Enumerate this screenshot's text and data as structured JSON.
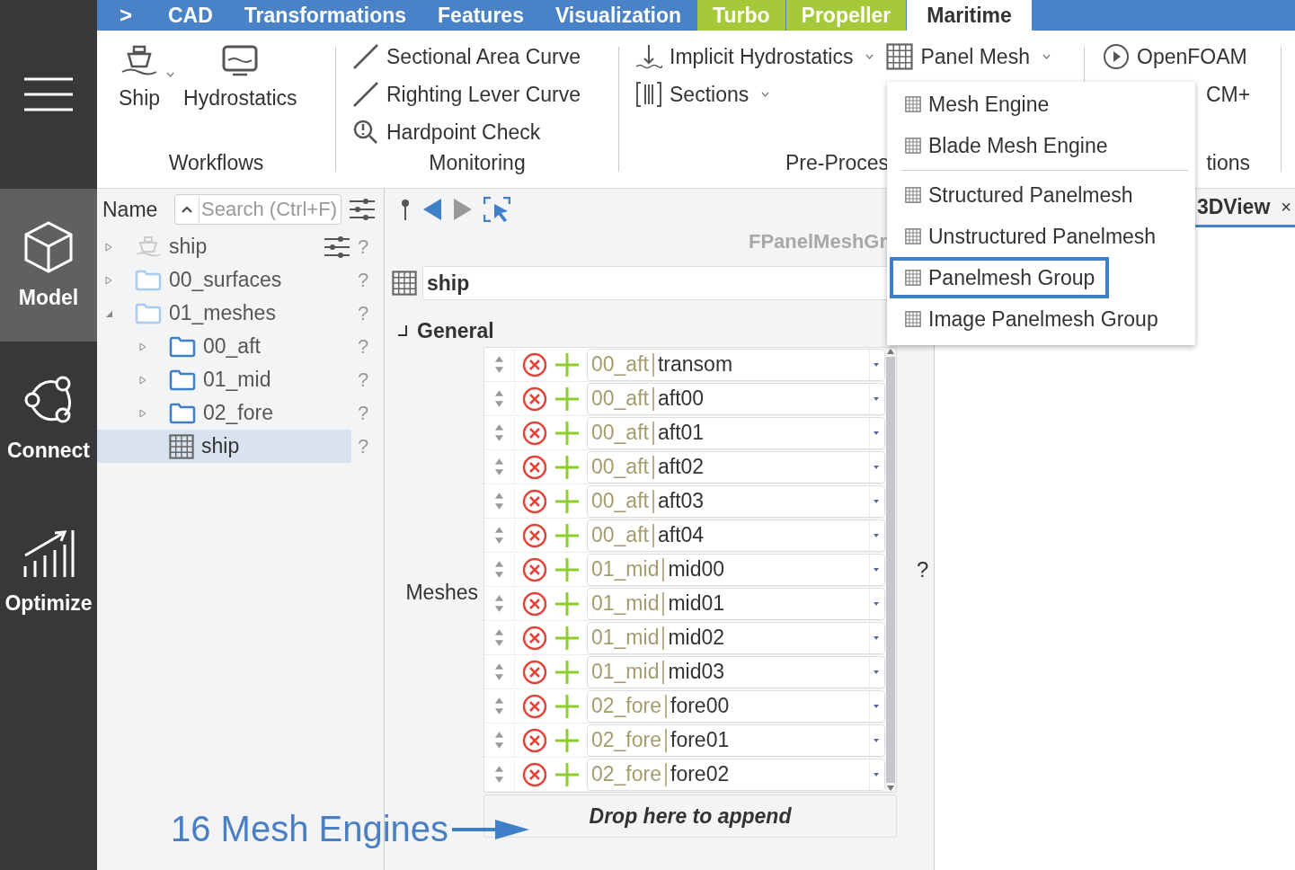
{
  "sidebar": [
    {
      "label": "Model",
      "kind": "cube",
      "selected": true
    },
    {
      "label": "Connect",
      "kind": "connect",
      "selected": false
    },
    {
      "label": "Optimize",
      "kind": "chart",
      "selected": false
    }
  ],
  "expand_glyph": ">",
  "tabs": [
    {
      "label": "CAD",
      "color": "#4a82c8",
      "selected": false
    },
    {
      "label": "Transformations",
      "color": "#4a82c8",
      "selected": false
    },
    {
      "label": "Features",
      "color": "#4a82c8",
      "selected": false
    },
    {
      "label": "Visualization",
      "color": "#4a82c8",
      "selected": false
    },
    {
      "label": "Turbo",
      "color": "#a6c93a",
      "selected": false
    },
    {
      "label": "Propeller",
      "color": "#a6c93a",
      "selected": false
    },
    {
      "label": "Maritime",
      "selected": true
    }
  ],
  "ribbon": {
    "groups": [
      {
        "kind": "large",
        "label": "Workflows",
        "items": [
          {
            "label": "Ship",
            "kind": "ship",
            "dropdown": true
          },
          {
            "label": "Hydrostatics",
            "kind": "monitor",
            "dropdown": false
          }
        ]
      },
      {
        "kind": "list",
        "label": "Monitoring",
        "columns": [
          [
            {
              "label": "Sectional Area Curve",
              "kind": "line",
              "dropdown": false
            },
            {
              "label": "Righting Lever Curve",
              "kind": "line",
              "dropdown": false
            },
            {
              "label": "Hardpoint Check",
              "kind": "magnifier",
              "dropdown": false
            }
          ]
        ]
      },
      {
        "kind": "list",
        "label": "Pre-Proces",
        "columns": [
          [
            {
              "label": "Implicit Hydrostatics",
              "kind": "arrow-down",
              "dropdown": true
            },
            {
              "label": "Sections",
              "kind": "sections",
              "dropdown": true
            }
          ],
          [
            {
              "label": "Panel Mesh",
              "kind": "grid",
              "dropdown": true
            }
          ]
        ]
      },
      {
        "kind": "list",
        "label": "tions",
        "columns": [
          [
            {
              "label": "OpenFOAM",
              "kind": "play",
              "dropdown": false
            },
            {
              "label": "CM+",
              "kind": "text",
              "dropdown": false
            }
          ]
        ]
      }
    ]
  },
  "menu": {
    "sections": [
      {
        "items": [
          {
            "label": "Mesh Engine",
            "selected": false
          },
          {
            "label": "Blade Mesh Engine",
            "selected": false
          }
        ]
      },
      {
        "items": [
          {
            "label": "Structured Panelmesh",
            "selected": false
          },
          {
            "label": "Unstructured Panelmesh",
            "selected": false
          },
          {
            "label": "Panelmesh Group",
            "selected": true
          },
          {
            "label": "Image Panelmesh Group",
            "selected": false
          }
        ]
      }
    ]
  },
  "tree": {
    "header": "Name",
    "search": {
      "placeholder": "Search (Ctrl+F)"
    },
    "nodes": [
      {
        "label": "ship",
        "kind": "ship",
        "help": "?",
        "expanded": false,
        "selected": false
      },
      {
        "label": "00_surfaces",
        "kind": "folder-light",
        "help": "?",
        "expanded": false,
        "selected": false
      },
      {
        "label": "01_meshes",
        "kind": "folder-light",
        "help": "?",
        "expanded": true,
        "selected": false,
        "children": [
          {
            "label": "00_aft",
            "kind": "folder",
            "help": "?",
            "expanded": false,
            "selected": false
          },
          {
            "label": "01_mid",
            "kind": "folder",
            "help": "?",
            "expanded": false,
            "selected": false
          },
          {
            "label": "02_fore",
            "kind": "folder",
            "help": "?",
            "expanded": false,
            "selected": false
          },
          {
            "label": "ship",
            "kind": "mesh",
            "help": "?",
            "selected": true
          }
        ]
      }
    ]
  },
  "properties": {
    "type_title": "FPanelMeshGr",
    "name": "ship",
    "section": "General",
    "meshes_label": "Meshes",
    "help": "?",
    "meshes": [
      {
        "prefix": "00_aft",
        "name": "transom"
      },
      {
        "prefix": "00_aft",
        "name": "aft00"
      },
      {
        "prefix": "00_aft",
        "name": "aft01"
      },
      {
        "prefix": "00_aft",
        "name": "aft02"
      },
      {
        "prefix": "00_aft",
        "name": "aft03"
      },
      {
        "prefix": "00_aft",
        "name": "aft04"
      },
      {
        "prefix": "01_mid",
        "name": "mid00"
      },
      {
        "prefix": "01_mid",
        "name": "mid01"
      },
      {
        "prefix": "01_mid",
        "name": "mid02"
      },
      {
        "prefix": "01_mid",
        "name": "mid03"
      },
      {
        "prefix": "02_fore",
        "name": "fore00"
      },
      {
        "prefix": "02_fore",
        "name": "fore01"
      },
      {
        "prefix": "02_fore",
        "name": "fore02"
      }
    ],
    "drop_hint": "Drop here to append"
  },
  "view": {
    "tab": "3DView",
    "close": "×"
  },
  "annotation": "16 Mesh Engines"
}
